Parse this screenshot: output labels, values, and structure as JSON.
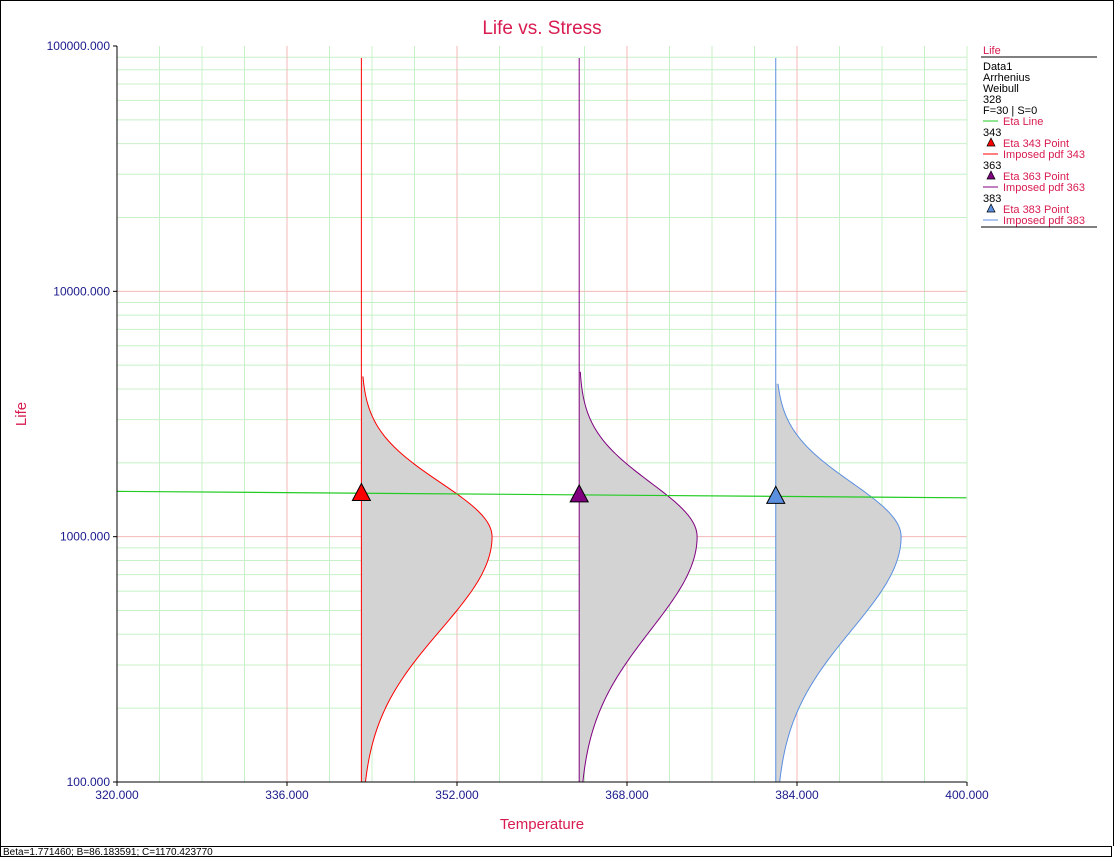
{
  "status": "Beta=1.771460; B=86.183591; C=1170.423770",
  "colors": {
    "title": "#d81b50",
    "tick": "#1a1a8c",
    "eta_line": "#22cc22",
    "minor_grid": "#c8f0c8",
    "major_grid": "#f4b8b8",
    "pdf_fill": "#d3d3d3"
  },
  "legend": {
    "header": "Life",
    "lines": [
      "Data1",
      "Arrhenius",
      "Weibull",
      "328",
      "F=30 | S=0"
    ],
    "eta_line_label": "Eta Line",
    "groups": [
      {
        "stress": "343",
        "point_label": "Eta 343 Point",
        "pdf_label": "Imposed pdf 343",
        "color": "#ff0000"
      },
      {
        "stress": "363",
        "point_label": "Eta 363 Point",
        "pdf_label": "Imposed pdf 363",
        "color": "#800080"
      },
      {
        "stress": "383",
        "point_label": "Eta 383 Point",
        "pdf_label": "Imposed pdf 383",
        "color": "#5b8fe0"
      }
    ]
  },
  "chart_data": {
    "type": "line",
    "title": "Life vs. Stress",
    "xlabel": "Temperature",
    "ylabel": "Life",
    "xlim": [
      320,
      400
    ],
    "ylim": [
      100,
      100000
    ],
    "yscale": "log",
    "xticks": [
      "320.000",
      "336.000",
      "352.000",
      "368.000",
      "384.000",
      "400.000"
    ],
    "yticks": [
      "100.000",
      "1000.000",
      "10000.000",
      "100000.000"
    ],
    "grid": true,
    "legend_position": "right",
    "eta_line": {
      "x": [
        320,
        400
      ],
      "y": [
        1530,
        1440
      ]
    },
    "series": [
      {
        "name": "343",
        "stress": 343,
        "eta_point": 1500,
        "pdf_x_start": 343,
        "pdf_peak_x": 355.3,
        "pdf_peak_life": 1000,
        "pdf_top_life": 4500
      },
      {
        "name": "363",
        "stress": 363.5,
        "eta_point": 1480,
        "pdf_x_start": 363.5,
        "pdf_peak_x": 374.6,
        "pdf_peak_life": 1000,
        "pdf_top_life": 4700
      },
      {
        "name": "383",
        "stress": 382,
        "eta_point": 1460,
        "pdf_x_start": 382,
        "pdf_peak_x": 393.8,
        "pdf_peak_life": 1000,
        "pdf_top_life": 4200
      }
    ]
  }
}
